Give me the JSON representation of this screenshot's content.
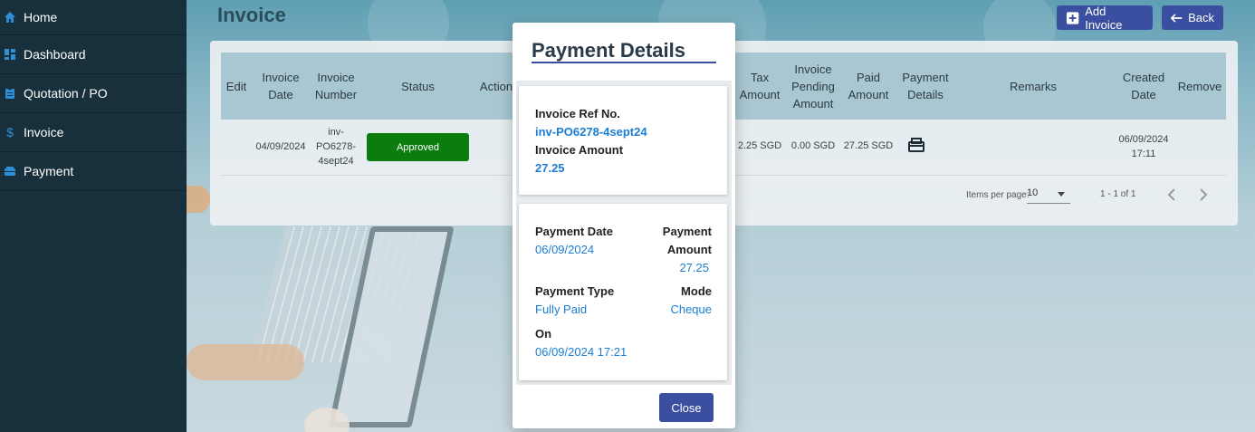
{
  "sidebar": {
    "items": [
      {
        "label": "Home",
        "icon": "home-icon"
      },
      {
        "label": "Dashboard",
        "icon": "dashboard-icon"
      },
      {
        "label": "Quotation / PO",
        "icon": "clipboard-icon"
      },
      {
        "label": "Invoice",
        "icon": "dollar-icon"
      },
      {
        "label": "Payment",
        "icon": "payment-icon"
      }
    ]
  },
  "header": {
    "title": "Invoice",
    "add_label": "Add Invoice",
    "back_label": "Back"
  },
  "table": {
    "columns": {
      "edit": "Edit",
      "invoice_date": "Invoice\nDate",
      "invoice_number": "Invoice\nNumber",
      "status": "Status",
      "action": "Action",
      "tax_amount": "Tax\nAmount",
      "pending_amount": "Invoice\nPending\nAmount",
      "paid_amount": "Paid\nAmount",
      "payment_details": "Payment\nDetails",
      "remarks": "Remarks",
      "created_date": "Created\nDate",
      "remove": "Remove"
    },
    "rows": [
      {
        "invoice_date": "04/09/2024",
        "invoice_number": "inv-\nPO6278-\n4sept24",
        "status": "Approved",
        "tax_amount": "2.25 SGD",
        "pending_amount": "0.00 SGD",
        "paid_amount": "27.25 SGD",
        "created_date": "06/09/2024\n17:11"
      }
    ]
  },
  "paginator": {
    "items_per_page_label": "Items per page:",
    "items_per_page_value": "10",
    "range_label": "1 - 1 of 1"
  },
  "modal": {
    "title": "Payment Details",
    "invoice_ref_label": "Invoice Ref No.",
    "invoice_ref_value": "inv-PO6278-4sept24",
    "invoice_amount_label": "Invoice Amount",
    "invoice_amount_value": "27.25",
    "payment_date_label": "Payment Date",
    "payment_date_value": "06/09/2024",
    "payment_amount_label_1": "Payment",
    "payment_amount_label_2": "Amount",
    "payment_amount_value": "27.25",
    "payment_type_label": "Payment Type",
    "payment_type_value": "Fully Paid",
    "mode_label": "Mode",
    "mode_value": "Cheque",
    "on_label": "On",
    "on_value": "06/09/2024 17:21",
    "close_label": "Close"
  },
  "colors": {
    "sidebar_bg": "#17303c",
    "primary": "#3b4fa0",
    "approved": "#0b7d0f",
    "link_blue": "#1a7fd4"
  }
}
